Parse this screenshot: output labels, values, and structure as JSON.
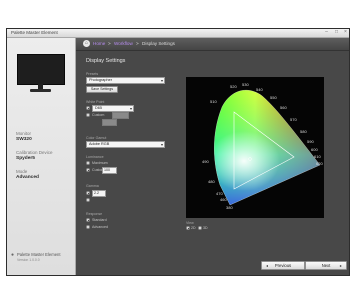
{
  "window": {
    "title": "Palette Master Element"
  },
  "breadcrumb": {
    "home": "Home",
    "step": "Workflow",
    "current": "Display Settings"
  },
  "sidebar": {
    "monitor_label": "Monitor",
    "monitor_value": "SW320",
    "calibration_label": "Calibration Device",
    "calibration_value": "Spyder5",
    "mode_label": "Mode",
    "mode_value": "Advanced",
    "footer_title": "Palette Master Element",
    "footer_sub": "Version 1.0.0.0"
  },
  "content": {
    "section_title": "Display Settings",
    "preset_label": "Presets",
    "preset_value": "Photographer",
    "save_settings_label": "Save Settings",
    "white_point_label": "White Point",
    "white_point_options": [
      "D65",
      "Custom"
    ],
    "gamut_label": "Color Gamut",
    "gamut_value": "Adobe RGB",
    "luminance_label": "Luminance",
    "luminance_options": [
      "Maximum",
      "Custom"
    ],
    "luminance_value": "100",
    "gamma_label": "Gamma",
    "gamma_value": "2.2",
    "response_label": "Response",
    "response_options": [
      "Standard",
      "Advanced"
    ],
    "view_label": "View",
    "view_options": [
      "2D",
      "3D"
    ]
  },
  "cie": {
    "wavelengths": [
      "520",
      "530",
      "540",
      "510",
      "550",
      "560",
      "570",
      "580",
      "590",
      "600",
      "610",
      "620",
      "490",
      "480",
      "470",
      "460",
      "380"
    ]
  },
  "nav": {
    "previous_label": "Previous",
    "next_label": "Next"
  },
  "colors": {
    "accent_link": "#b68cf0",
    "panel": "#484848",
    "sidebar": "#e6e6e6"
  }
}
